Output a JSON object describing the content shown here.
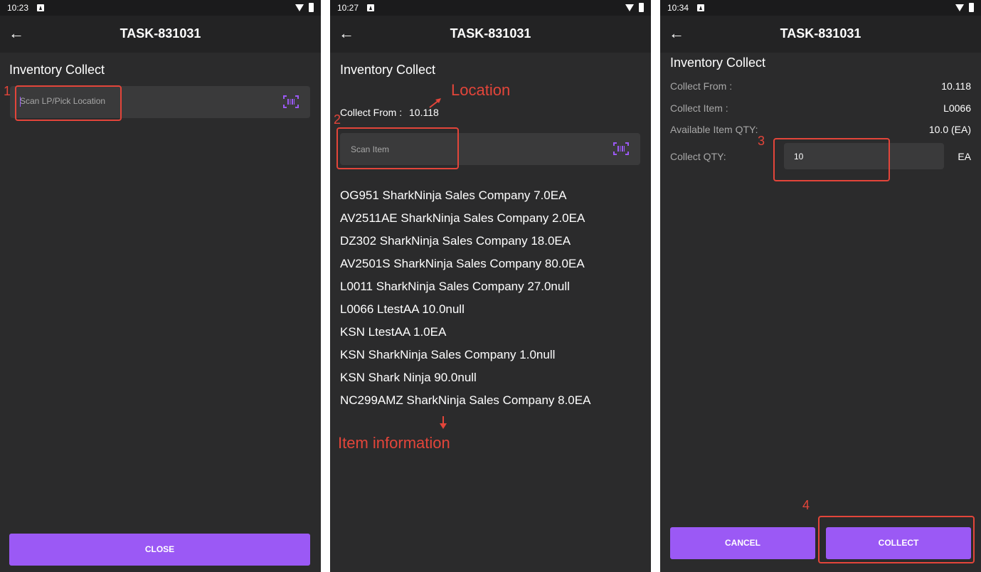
{
  "screens": [
    {
      "status": {
        "time": "10:23"
      },
      "app_bar": {
        "title": "TASK-831031"
      },
      "heading": "Inventory Collect",
      "scan_input": {
        "placeholder": "Scan LP/Pick Location"
      },
      "annotation_number": "1",
      "close_button": "CLOSE"
    },
    {
      "status": {
        "time": "10:27"
      },
      "app_bar": {
        "title": "TASK-831031"
      },
      "heading": "Inventory Collect",
      "collect_from": {
        "label": "Collect From :",
        "value": "10.118"
      },
      "scan_input": {
        "placeholder": "Scan Item"
      },
      "annotation_number": "2",
      "annotation_location": "Location",
      "annotation_item_information": "Item information",
      "items": [
        "OG951 SharkNinja Sales Company 7.0EA",
        "AV2511AE SharkNinja Sales Company 2.0EA",
        "DZ302 SharkNinja Sales Company 18.0EA",
        "AV2501S SharkNinja Sales Company 80.0EA",
        "L0011 SharkNinja Sales Company 27.0null",
        "L0066 LtestAA 10.0null",
        "KSN LtestAA 1.0EA",
        "KSN SharkNinja Sales Company 1.0null",
        "KSN Shark Ninja 90.0null",
        "NC299AMZ SharkNinja Sales Company 8.0EA"
      ]
    },
    {
      "status": {
        "time": "10:34"
      },
      "app_bar": {
        "title": "TASK-831031"
      },
      "heading": "Inventory Collect",
      "details": [
        {
          "label": "Collect From :",
          "value": "10.118"
        },
        {
          "label": "Collect Item :",
          "value": "L0066"
        },
        {
          "label": "Available Item QTY:",
          "value": "10.0 (EA)"
        }
      ],
      "collect_qty": {
        "label": "Collect QTY:",
        "value": "10",
        "unit": "EA"
      },
      "annotation_number_3": "3",
      "annotation_number_4": "4",
      "cancel_button": "CANCEL",
      "collect_button": "COLLECT"
    }
  ],
  "colors": {
    "background": "#2b2b2c",
    "app_bar": "#232324",
    "input": "#3a3a3b",
    "accent": "#9b59f5",
    "annotation": "#e3453a"
  }
}
